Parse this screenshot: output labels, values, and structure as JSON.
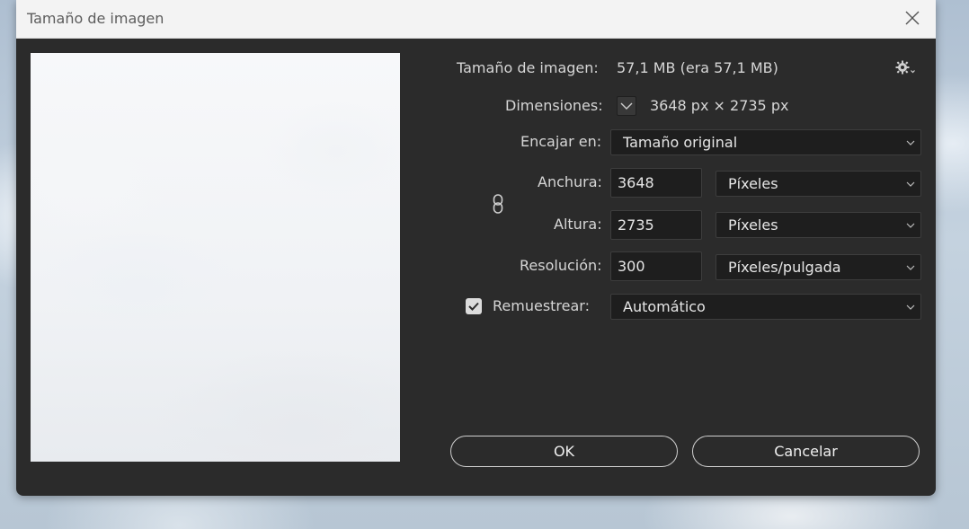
{
  "window": {
    "title": "Tamaño de imagen"
  },
  "info": {
    "image_size_label": "Tamaño de imagen:",
    "image_size_value": "57,1 MB (era 57,1 MB)",
    "dimensions_label": "Dimensiones:",
    "dimensions_value": "3648 px × 2735 px"
  },
  "fit": {
    "label": "Encajar en:",
    "value": "Tamaño original"
  },
  "width": {
    "label": "Anchura:",
    "value": "3648",
    "unit": "Píxeles"
  },
  "height": {
    "label": "Altura:",
    "value": "2735",
    "unit": "Píxeles"
  },
  "resolution": {
    "label": "Resolución:",
    "value": "300",
    "unit": "Píxeles/pulgada"
  },
  "resample": {
    "label": "Remuestrear:",
    "checked": true,
    "value": "Automático"
  },
  "buttons": {
    "ok": "OK",
    "cancel": "Cancelar"
  },
  "icons": {
    "close": "close-icon",
    "gear": "gear-icon",
    "chevron": "chevron-down-icon",
    "link": "link-icon",
    "check": "checkmark-icon"
  },
  "colors": {
    "dialog_bg": "#2b2b2b",
    "field_bg": "#1e1e1e",
    "label_text": "#d6d6d6"
  }
}
